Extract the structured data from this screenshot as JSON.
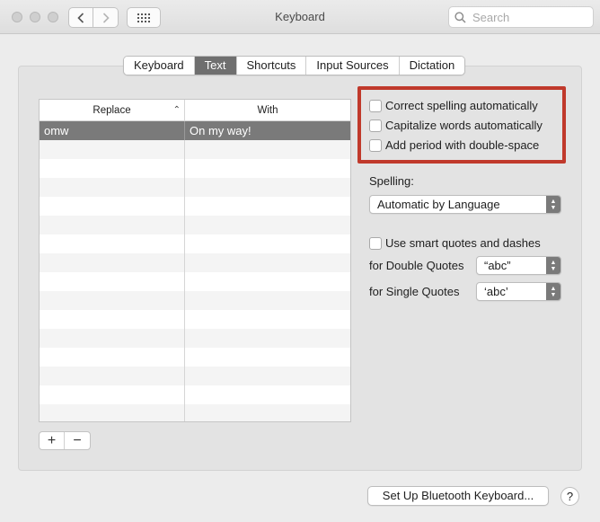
{
  "window": {
    "title": "Keyboard"
  },
  "search": {
    "placeholder": "Search"
  },
  "tabs": [
    {
      "label": "Keyboard"
    },
    {
      "label": "Text"
    },
    {
      "label": "Shortcuts"
    },
    {
      "label": "Input Sources"
    },
    {
      "label": "Dictation"
    }
  ],
  "active_tab": "Text",
  "table": {
    "columns": [
      "Replace",
      "With"
    ],
    "rows": [
      {
        "replace": "omw",
        "with": "On my way!"
      }
    ]
  },
  "options": {
    "correct_spelling": {
      "label": "Correct spelling automatically",
      "checked": false
    },
    "capitalize_words": {
      "label": "Capitalize words automatically",
      "checked": false
    },
    "add_period": {
      "label": "Add period with double-space",
      "checked": false
    },
    "spelling_label": "Spelling:",
    "spelling_value": "Automatic by Language",
    "smart_quotes": {
      "label": "Use smart quotes and dashes",
      "checked": false
    },
    "double_quotes_label": "for Double Quotes",
    "double_quotes_value": "“abc”",
    "single_quotes_label": "for Single Quotes",
    "single_quotes_value": "‘abc’"
  },
  "buttons": {
    "add": "+",
    "remove": "−",
    "bluetooth": "Set Up Bluetooth Keyboard...",
    "help": "?"
  },
  "colors": {
    "highlight": "#c0392b",
    "selection": "#7a7a7a",
    "active_tab": "#6f6f6f"
  }
}
